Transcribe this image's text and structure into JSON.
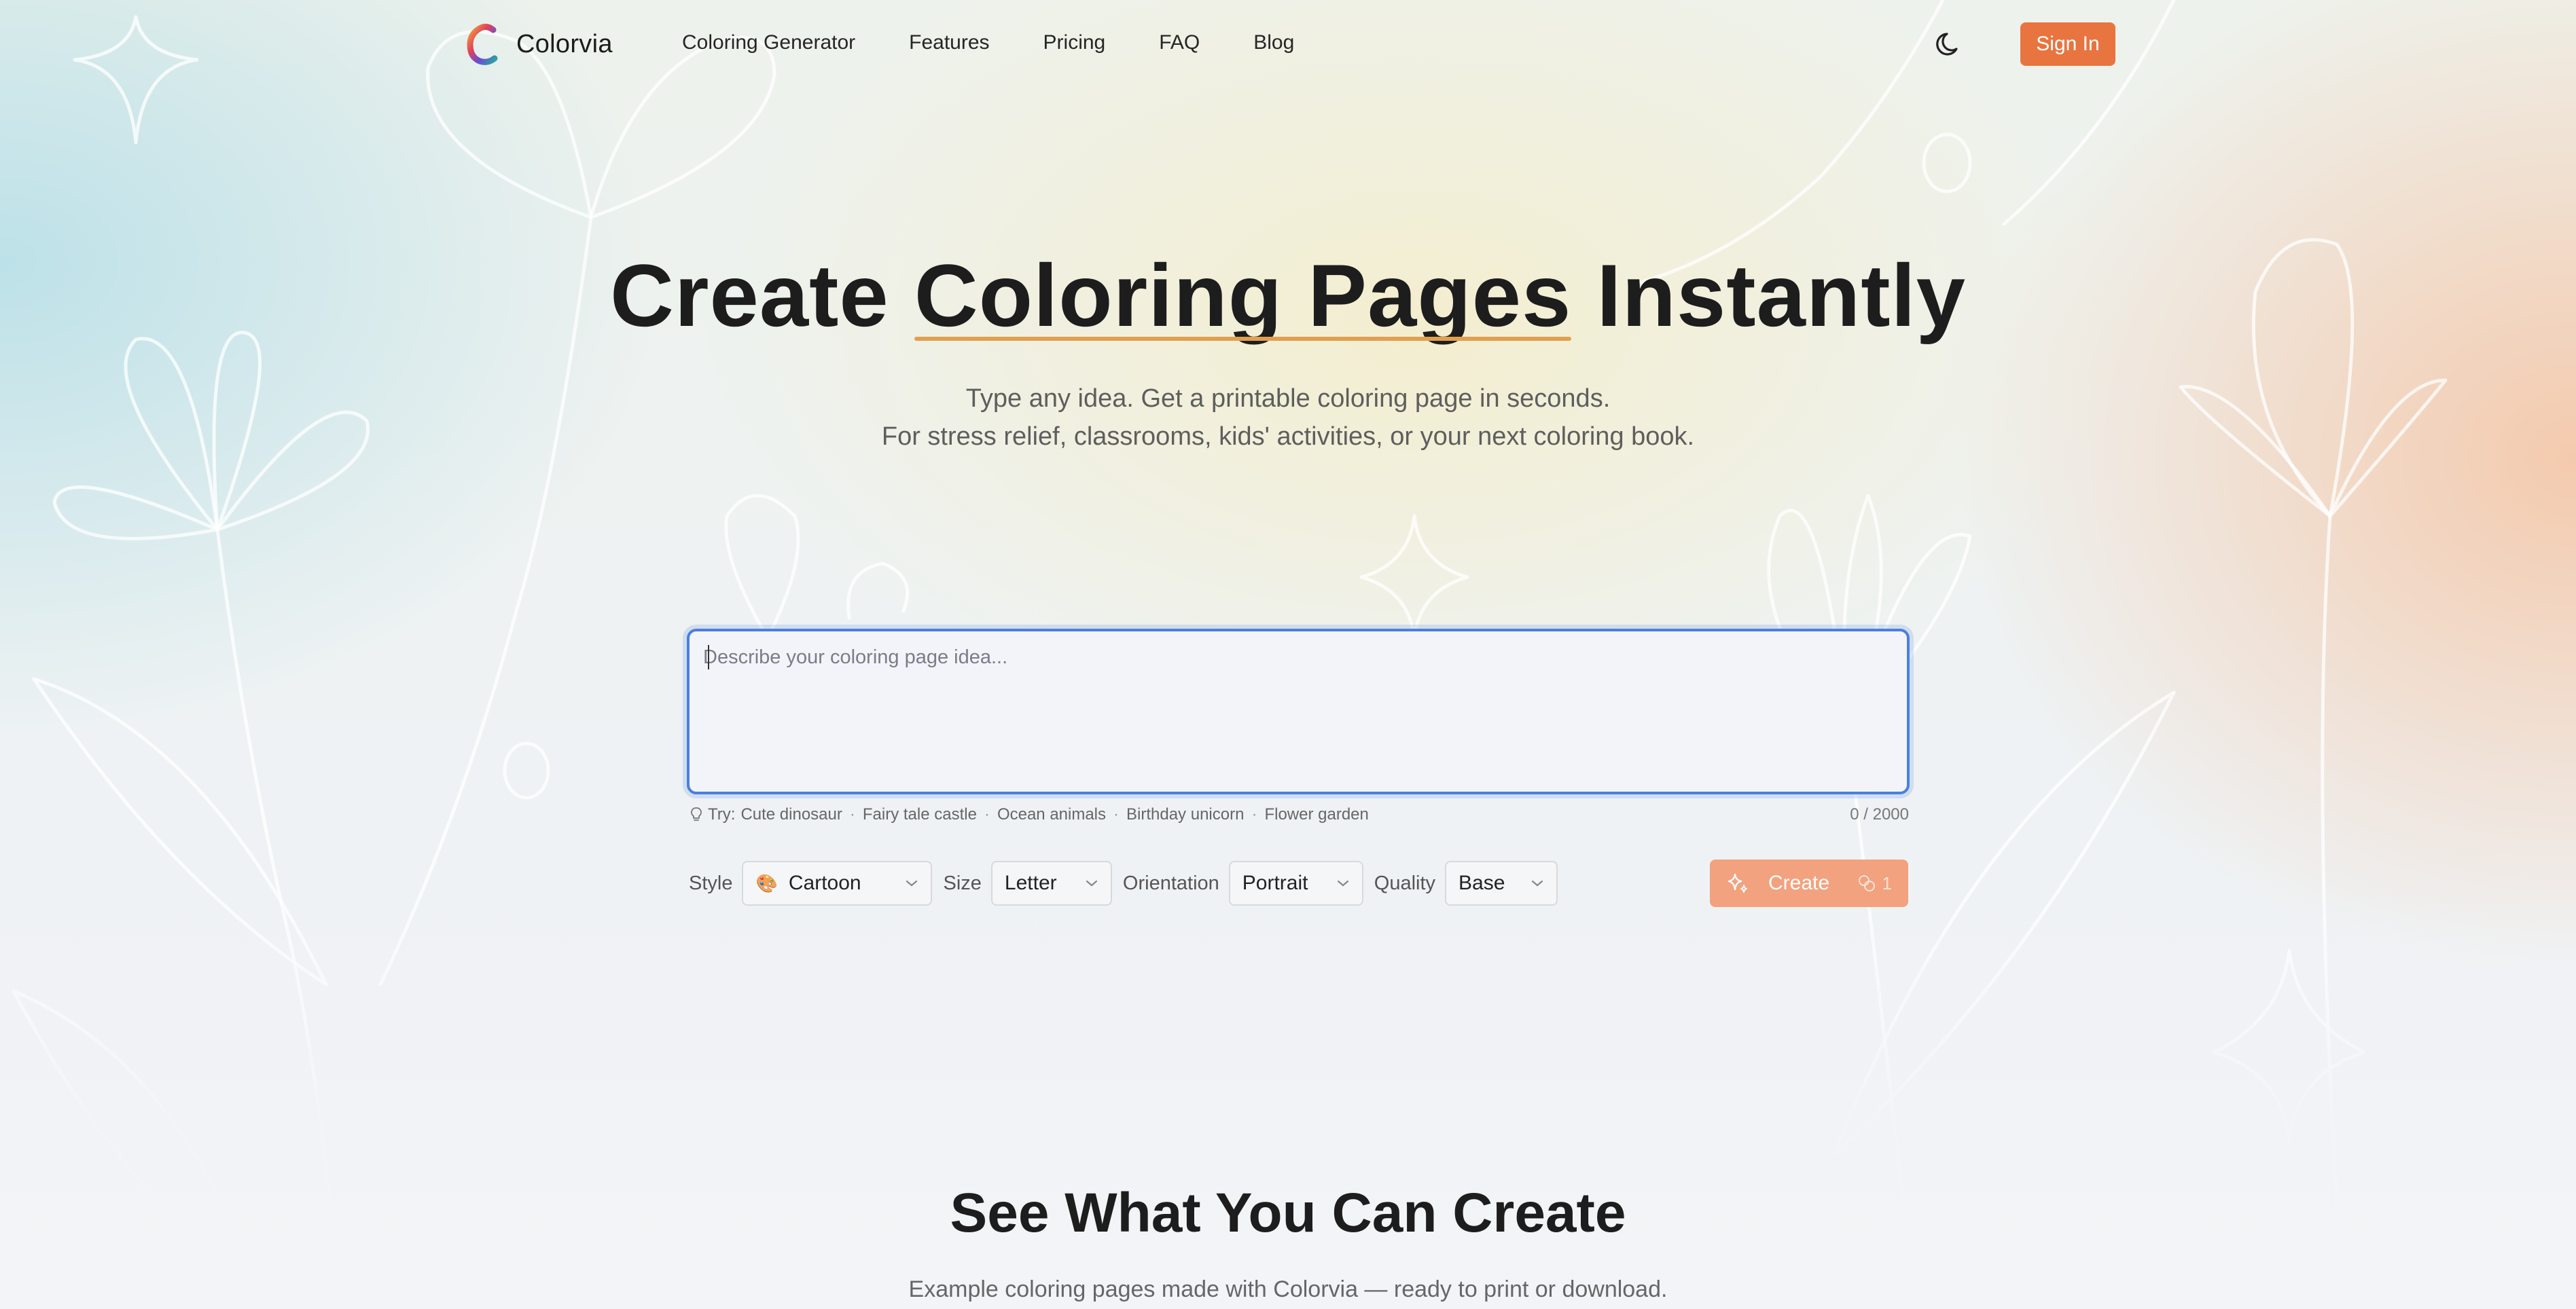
{
  "colors": {
    "accent": "#e8743f",
    "create_button": "#f2a27e",
    "focus_ring": "#4a7fe0",
    "underline": "#e0a050"
  },
  "nav": {
    "brand": "Colorvia",
    "links": [
      "Coloring Generator",
      "Features",
      "Pricing",
      "FAQ",
      "Blog"
    ],
    "sign_in": "Sign In",
    "theme_icon": "moon-icon"
  },
  "hero": {
    "title_before": "Create ",
    "title_highlight": "Coloring Pages",
    "title_after": " Instantly",
    "subtitle_line1": "Type any idea. Get a printable coloring page in seconds.",
    "subtitle_line2": "For stress relief, classrooms, kids' activities, or your next coloring book."
  },
  "prompt": {
    "placeholder": "Describe your coloring page idea...",
    "value": "",
    "try_label": "Try:",
    "suggestions": [
      "Cute dinosaur",
      "Fairy tale castle",
      "Ocean animals",
      "Birthday unicorn",
      "Flower garden"
    ],
    "char_count": "0 / 2000"
  },
  "options": {
    "style_label": "Style",
    "style_value": "Cartoon",
    "style_icon": "palette-icon",
    "size_label": "Size",
    "size_value": "Letter",
    "orientation_label": "Orientation",
    "orientation_value": "Portrait",
    "quality_label": "Quality",
    "quality_value": "Base"
  },
  "create": {
    "label": "Create",
    "credits": "1",
    "icon": "sparkle-icon",
    "credit_icon": "coins-icon"
  },
  "examples": {
    "title": "See What You Can Create",
    "subtitle": "Example coloring pages made with Colorvia — ready to print or download."
  }
}
